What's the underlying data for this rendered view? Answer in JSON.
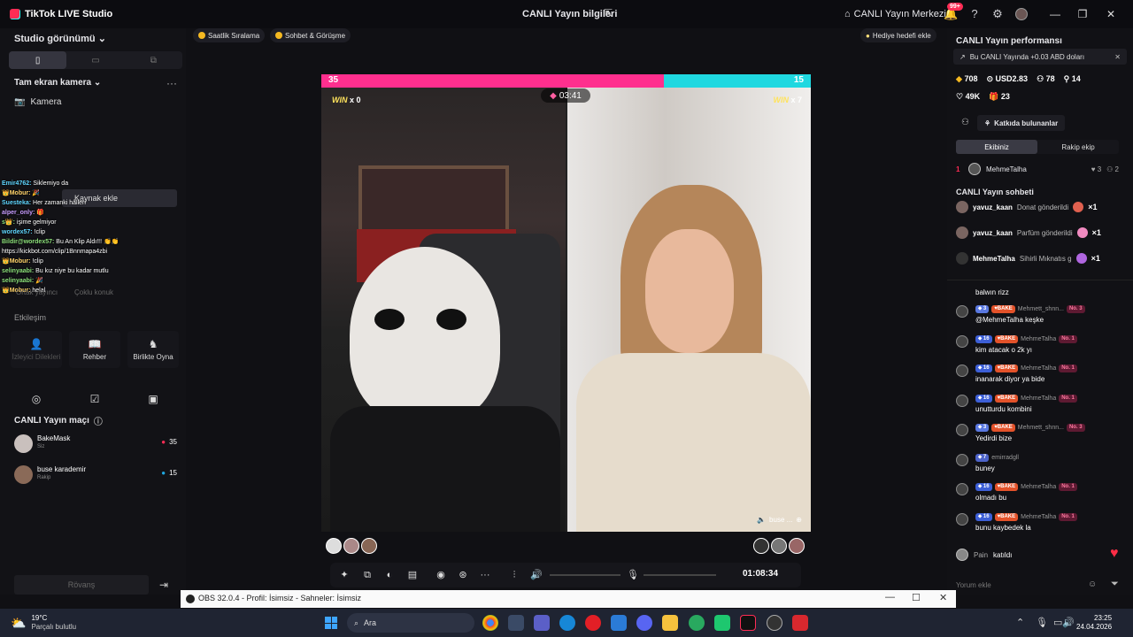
{
  "titlebar": {
    "app_name": "TikTok LIVE Studio",
    "live_info": "CANLI Yayın bilgileri",
    "live_center": "CANLI Yayın Merkezi",
    "notif_count": "99+"
  },
  "left": {
    "studio_view": "Studio görünümü",
    "camera_section": "Tam ekran kamera",
    "camera_item": "Kamera",
    "add_source": "Kaynak ekle",
    "ghost_labels": [
      "Ortak yayıncı",
      "Çoklu konuk"
    ],
    "interaction_label": "Etkileşim",
    "tiles": [
      {
        "label": "İzleyici Dilekleri",
        "icon": "person-icon",
        "enabled": false
      },
      {
        "label": "Rehber",
        "icon": "book-icon",
        "enabled": true
      },
      {
        "label": "Birlikte Oyna",
        "icon": "gamepad-icon",
        "enabled": true
      }
    ],
    "overlay_chat": [
      {
        "name": "Emir4762:",
        "text": " Siklemiyo da",
        "c": ""
      },
      {
        "name": "👑Mobur:",
        "text": " 🎉",
        "c": "y"
      },
      {
        "name": "Suesteka:",
        "text": " Her zamanki hâlleri",
        "c": ""
      },
      {
        "name": "alper_only:",
        "text": " 🎁",
        "c": "p"
      },
      {
        "name": "s👑:",
        "text": " işime gelmiyor",
        "c": "g"
      },
      {
        "name": "wordex57:",
        "text": " !clip",
        "c": ""
      },
      {
        "name": "Bildir@wordex57:",
        "text": " Bu An Klip Aldı!!! 👏👏",
        "c": "g"
      },
      {
        "name": "",
        "text": "https://kickbot.com/clip/1Bnnmapa4zbi",
        "c": ""
      },
      {
        "name": "👑Mobur:",
        "text": " !clip",
        "c": "y"
      },
      {
        "name": "selinyaabi:",
        "text": " Bu kız niye bu kadar mutlu",
        "c": "g"
      },
      {
        "name": "selinyaabi:",
        "text": " 🎉",
        "c": "g"
      },
      {
        "name": "👑Mobur:",
        "text": " helal",
        "c": "y"
      }
    ],
    "match": {
      "title": "CANLI Yayın maçı",
      "players": [
        {
          "name": "BakeMask",
          "role": "Siz",
          "score": "35",
          "badge_color": "#fe2c55"
        },
        {
          "name": "buse karademir",
          "role": "Rakip",
          "score": "15",
          "badge_color": "#1fa8e0"
        }
      ],
      "rematch": "Rövanş"
    }
  },
  "top_pills": {
    "hourly": "Saatlik Sıralama",
    "chat_meet": "Sohbet & Görüşme",
    "gift_goal": "Hediye hedefi ekle"
  },
  "battle": {
    "score_left": "35",
    "score_right": "15",
    "score_left_share": 0.7,
    "timer": "03:41",
    "win_left_label": "WIN",
    "win_left": "x 0",
    "win_right_label": "WIN",
    "win_right": "x 7",
    "opponent_tag": "buse ..."
  },
  "controls": {
    "elapsed": "01:08:34",
    "volume_level": 0.0,
    "mic_level": 0.0
  },
  "right": {
    "perf_title": "CANLI Yayın performansı",
    "earn_text": "Bu CANLI Yayında +0.03 ABD doları",
    "stats1": [
      "708",
      "USD2.83",
      "78",
      "14"
    ],
    "stats2": [
      "49K",
      "23"
    ],
    "contributors_btn": "Katkıda bulunanlar",
    "tab_ours": "Ekibiniz",
    "tab_rival": "Rakip ekip",
    "rank": {
      "num": "1",
      "name": "MehmeTalha",
      "hearts": "3",
      "people": "2"
    },
    "chat_title": "CANLI Yayın sohbeti",
    "gift_lines": [
      {
        "name": "yavuz_kaan",
        "text": "Donat gönderildi",
        "mult": "×1"
      },
      {
        "name": "yavuz_kaan",
        "text": "Parfüm gönderildi",
        "mult": "×1"
      },
      {
        "name": "MehmeTalha",
        "text": "Sihirli Mıknatıs g",
        "mult": "×1"
      }
    ],
    "partial_msg": "balwın rizz",
    "messages": [
      {
        "lvl": "3",
        "fan": "BAKE",
        "user": "Mehmett_shnn...",
        "rank": "No. 3",
        "text": "@MehmeTalha keşke"
      },
      {
        "lvl": "16",
        "fan": "BAKE",
        "user": "MehmeTalha",
        "rank": "No. 1",
        "text": "kim atacak o 2k yı"
      },
      {
        "lvl": "16",
        "fan": "BAKE",
        "user": "MehmeTalha",
        "rank": "No. 1",
        "text": "inanarak diyor ya bide"
      },
      {
        "lvl": "16",
        "fan": "BAKE",
        "user": "MehmeTalha",
        "rank": "No. 1",
        "text": "unutturdu kombini"
      },
      {
        "lvl": "3",
        "fan": "BAKE",
        "user": "Mehmett_shnn...",
        "rank": "No. 3",
        "text": "Yedirdi bize"
      },
      {
        "lvl": "7",
        "fan": "",
        "user": "emirradgll",
        "rank": "",
        "text": "buney"
      },
      {
        "lvl": "16",
        "fan": "BAKE",
        "user": "MehmeTalha",
        "rank": "No. 1",
        "text": "olmadı bu"
      },
      {
        "lvl": "16",
        "fan": "BAKE",
        "user": "MehmeTalha",
        "rank": "No. 1",
        "text": "bunu kaybedek la"
      }
    ],
    "joined_user": "Pain",
    "joined_text": "katıldı",
    "comment_placeholder": "Yorum ekle"
  },
  "obs": {
    "title": "OBS 32.0.4 - Profil: İsimsiz - Sahneler: İsimsiz"
  },
  "taskbar": {
    "temp": "19°C",
    "weather": "Parçalı bulutlu",
    "search": "Ara",
    "time": "23:25",
    "date": "24.04.2026"
  },
  "colors": {
    "pink": "#ff2f8e",
    "cyan": "#1fd8e0",
    "accent": "#fe2c55"
  }
}
